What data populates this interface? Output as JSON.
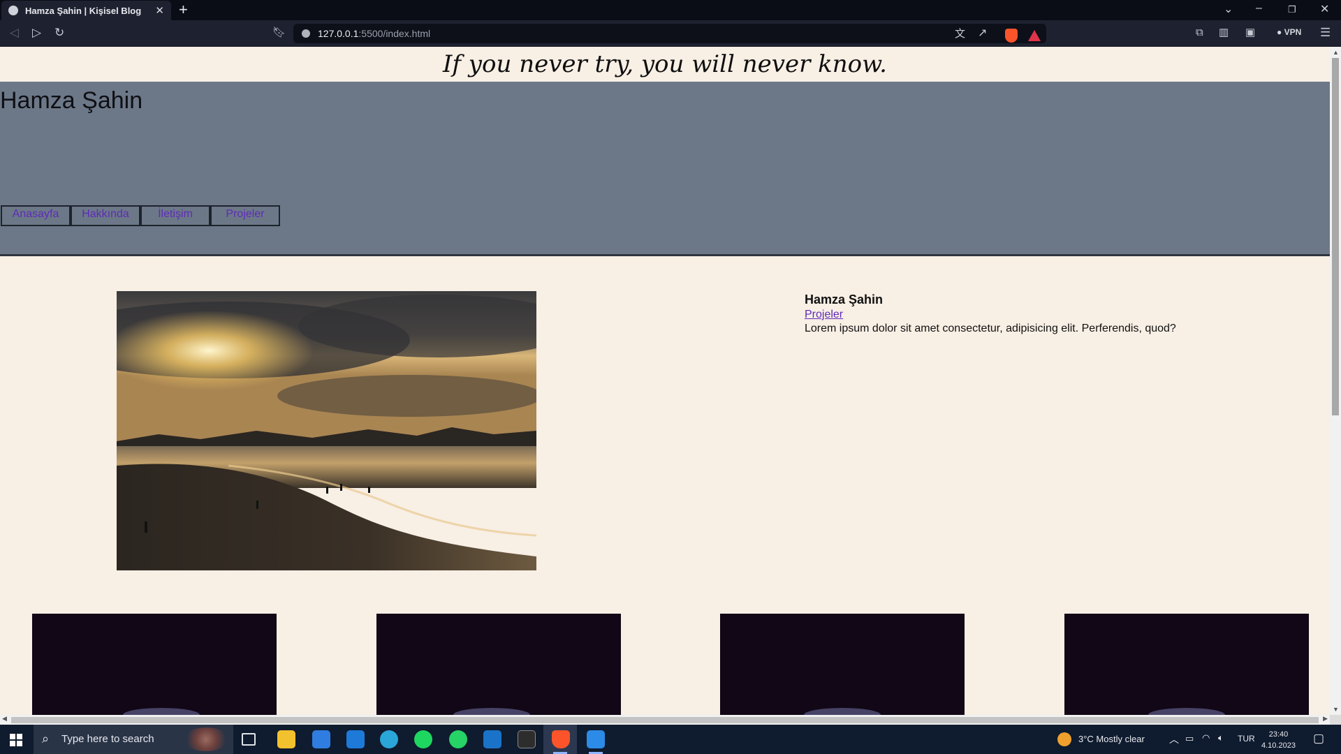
{
  "browser": {
    "tab_title": "Hamza Şahin | Kişisel Blog",
    "url_host": "127.0.0.1",
    "url_rest": ":5500/index.html",
    "vpn_label": "VPN"
  },
  "page": {
    "quote": "If you never try, you will never know.",
    "site_title": "Hamza Şahin",
    "nav": [
      {
        "label": "Anasayfa"
      },
      {
        "label": "Hakkında"
      },
      {
        "label": "İletişim"
      },
      {
        "label": "Projeler"
      }
    ],
    "about": {
      "name": "Hamza Şahin",
      "link": "Projeler",
      "text": "Lorem ipsum dolor sit amet consectetur, adipisicing elit. Perferendis, quod?"
    }
  },
  "taskbar": {
    "search_placeholder": "Type here to search",
    "weather": "3°C  Mostly clear",
    "language": "TUR",
    "time": "23:40",
    "date": "4.10.2023"
  },
  "colors": {
    "page_bg": "#f8efe5",
    "header_bg": "#6c7888",
    "link": "#5e2bb8"
  }
}
